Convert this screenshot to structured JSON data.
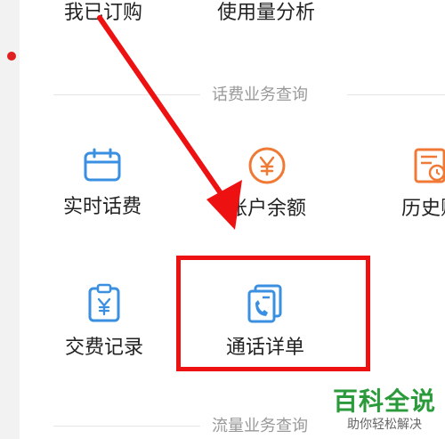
{
  "top_row": {
    "subscribed": "我已订购",
    "usage_analysis": "使用量分析"
  },
  "fee_section": {
    "title": "话费业务查询",
    "items": [
      {
        "label": "实时话费",
        "icon": "calendar-icon"
      },
      {
        "label": "账户余额",
        "icon": "yen-coin-icon"
      },
      {
        "label": "历史账",
        "icon": "bill-history-icon"
      },
      {
        "label": "交费记录",
        "icon": "payment-clipboard-icon"
      },
      {
        "label": "通话详单",
        "icon": "call-detail-icon"
      }
    ]
  },
  "flow_section": {
    "title": "流量业务查询"
  },
  "watermark": {
    "big": "百科全说",
    "small": "助你轻松解决"
  },
  "colors": {
    "icon_blue": "#3a8fe0",
    "icon_orange": "#f07a35",
    "annotation_red": "#ee1111",
    "watermark_green": "#2a9a3a"
  }
}
